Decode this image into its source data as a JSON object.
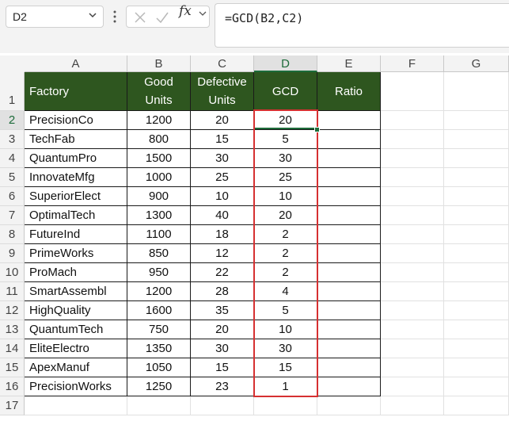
{
  "name_box": {
    "value": "D2"
  },
  "formula_bar": {
    "fx_label": "fx",
    "formula": "=GCD(B2,C2)"
  },
  "columns": [
    "A",
    "B",
    "C",
    "D",
    "E",
    "F",
    "G"
  ],
  "header_row": {
    "row_num": "1",
    "factory": "Factory",
    "good_units_l1": "Good",
    "good_units_l2": "Units",
    "defective_l1": "Defective",
    "defective_l2": "Units",
    "gcd": "GCD",
    "ratio": "Ratio"
  },
  "rows": [
    {
      "num": "2",
      "factory": "PrecisionCo",
      "good": "1200",
      "defective": "20",
      "gcd": "20"
    },
    {
      "num": "3",
      "factory": "TechFab",
      "good": "800",
      "defective": "15",
      "gcd": "5"
    },
    {
      "num": "4",
      "factory": "QuantumPro",
      "good": "1500",
      "defective": "30",
      "gcd": "30"
    },
    {
      "num": "5",
      "factory": "InnovateMfg",
      "good": "1000",
      "defective": "25",
      "gcd": "25"
    },
    {
      "num": "6",
      "factory": "SuperiorElect",
      "good": "900",
      "defective": "10",
      "gcd": "10"
    },
    {
      "num": "7",
      "factory": "OptimalTech",
      "good": "1300",
      "defective": "40",
      "gcd": "20"
    },
    {
      "num": "8",
      "factory": "FutureInd",
      "good": "1100",
      "defective": "18",
      "gcd": "2"
    },
    {
      "num": "9",
      "factory": "PrimeWorks",
      "good": "850",
      "defective": "12",
      "gcd": "2"
    },
    {
      "num": "10",
      "factory": "ProMach",
      "good": "950",
      "defective": "22",
      "gcd": "2"
    },
    {
      "num": "11",
      "factory": "SmartAssembl",
      "good": "1200",
      "defective": "28",
      "gcd": "4"
    },
    {
      "num": "12",
      "factory": "HighQuality",
      "good": "1600",
      "defective": "35",
      "gcd": "5"
    },
    {
      "num": "13",
      "factory": "QuantumTech",
      "good": "750",
      "defective": "20",
      "gcd": "10"
    },
    {
      "num": "14",
      "factory": "EliteElectro",
      "good": "1350",
      "defective": "30",
      "gcd": "30"
    },
    {
      "num": "15",
      "factory": "ApexManuf",
      "good": "1050",
      "defective": "15",
      "gcd": "15"
    },
    {
      "num": "16",
      "factory": "PrecisionWorks",
      "good": "1250",
      "defective": "23",
      "gcd": "1"
    }
  ],
  "empty_rows": [
    "17"
  ]
}
